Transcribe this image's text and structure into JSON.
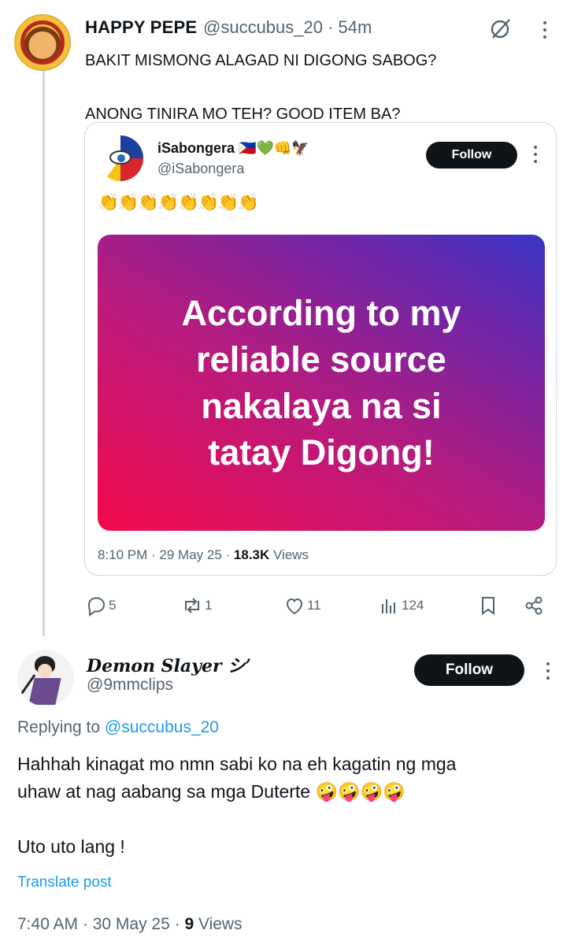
{
  "post": {
    "display_name": "HAPPY PEPE",
    "handle_time": "@succubus_20 · 54m",
    "text": "BAKIT MISMONG ALAGAD NI DIGONG SABOG?\n\nANONG TINIRA MO TEH? GOOD ITEM BA?"
  },
  "quote": {
    "display_name": "iSabongera 🇵🇭💚👊🦅",
    "handle": "@iSabongera",
    "follow_label": "Follow",
    "body": "👏👏👏👏👏👏👏👏",
    "image_text": "According to my\nreliable source\nnakalaya na si\ntatay Digong!",
    "meta_prefix": "8:10 PM · 29 May 25 · ",
    "views_count": "18.3K",
    "views_label": " Views"
  },
  "actions": {
    "replies": "5",
    "reposts": "1",
    "likes": "11",
    "views": "124"
  },
  "reply": {
    "display_name": "Demon Slayer シ’",
    "handle": "@9mmclips",
    "follow_label": "Follow",
    "replying_prefix": "Replying to ",
    "replying_handle": "@succubus_20",
    "text": "Hahhah kinagat mo nmn sabi ko na eh kagatin ng mga\nuhaw at nag aabang sa mga Duterte 🤪🤪🤪🤪\n\nUto uto lang !",
    "translate_label": "Translate post",
    "meta_prefix": "7:40 AM · 30 May 25 · ",
    "views_count": "9",
    "views_label": " Views"
  },
  "icons": [
    "grok-icon",
    "more-icon",
    "reply-icon",
    "repost-icon",
    "like-icon",
    "views-icon",
    "bookmark-icon",
    "share-icon"
  ]
}
